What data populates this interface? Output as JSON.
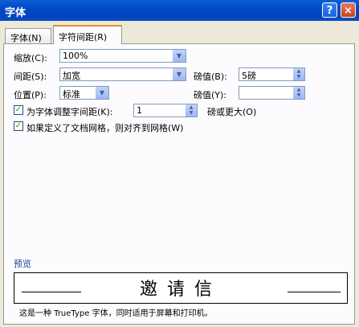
{
  "window": {
    "title": "字体",
    "help_icon": "?",
    "close_icon": "×"
  },
  "tabs": [
    {
      "label": "字体(N)",
      "active": false
    },
    {
      "label": "字符间距(R)",
      "active": true
    }
  ],
  "scale": {
    "label": "缩放(C):",
    "value": "100%"
  },
  "spacing": {
    "label": "间距(S):",
    "value": "加宽",
    "by_label": "磅值(B):",
    "by_value": "5磅"
  },
  "position": {
    "label": "位置(P):",
    "value": "标准",
    "by_label": "磅值(Y):",
    "by_value": ""
  },
  "kerning": {
    "label": "为字体调整字间距(K):",
    "checked": true,
    "value": "1",
    "suffix": "磅或更大(O)"
  },
  "grid": {
    "label": "如果定义了文档网格，则对齐到网格(W)",
    "checked": true
  },
  "preview": {
    "label": "预览",
    "sample": "邀请信",
    "description": "这是一种 TrueType 字体，同时适用于屏幕和打印机。"
  }
}
